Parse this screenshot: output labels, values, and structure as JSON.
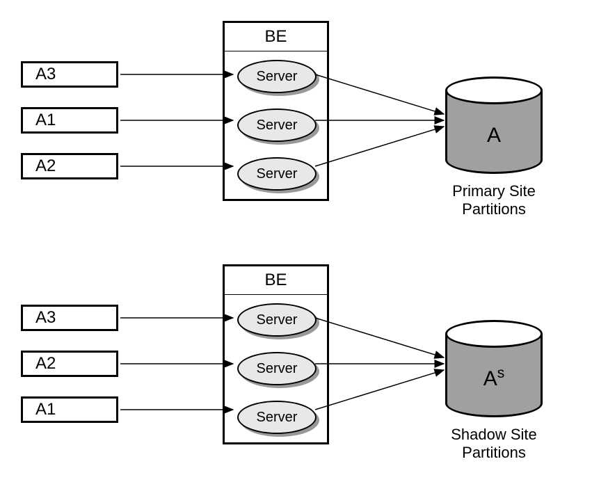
{
  "diagram_type": "architecture",
  "sections": [
    {
      "inputs": [
        "A3",
        "A1",
        "A2"
      ],
      "be_label": "BE",
      "servers": [
        "Server",
        "Server",
        "Server"
      ],
      "cylinder_label": "A",
      "cylinder_label_sup": "",
      "caption": "Primary Site Partitions"
    },
    {
      "inputs": [
        "A3",
        "A2",
        "A1"
      ],
      "be_label": "BE",
      "servers": [
        "Server",
        "Server",
        "Server"
      ],
      "cylinder_label": "A",
      "cylinder_label_sup": "s",
      "caption": "Shadow Site Partitions"
    }
  ]
}
